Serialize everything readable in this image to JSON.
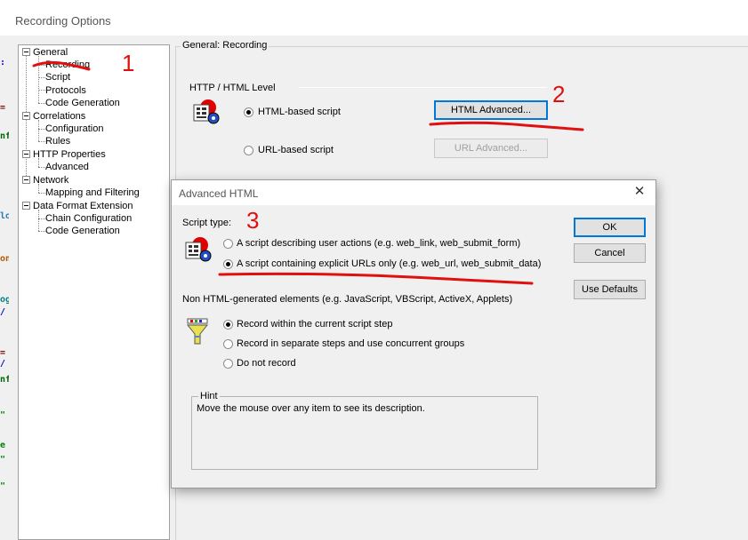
{
  "window": {
    "title": "Recording Options"
  },
  "tree": {
    "items": [
      {
        "label": "General",
        "level": 0,
        "expander": true
      },
      {
        "label": "Recording",
        "level": 1,
        "selected": true
      },
      {
        "label": "Script",
        "level": 1
      },
      {
        "label": "Protocols",
        "level": 1
      },
      {
        "label": "Code Generation",
        "level": 1
      },
      {
        "label": "Correlations",
        "level": 0,
        "expander": true
      },
      {
        "label": "Configuration",
        "level": 1
      },
      {
        "label": "Rules",
        "level": 1
      },
      {
        "label": "HTTP Properties",
        "level": 0,
        "expander": true
      },
      {
        "label": "Advanced",
        "level": 1
      },
      {
        "label": "Network",
        "level": 0,
        "expander": true
      },
      {
        "label": "Mapping and Filtering",
        "level": 1
      },
      {
        "label": "Data Format Extension",
        "level": 0,
        "expander": true
      },
      {
        "label": "Chain Configuration",
        "level": 1
      },
      {
        "label": "Code Generation",
        "level": 1
      }
    ]
  },
  "general_panel": {
    "group_title": "General: Recording",
    "level_title": "HTTP / HTML Level",
    "html_based_label": "HTML-based script",
    "url_based_label": "URL-based script",
    "html_advanced_button": "HTML Advanced...",
    "url_advanced_button": "URL Advanced..."
  },
  "dialog": {
    "title": "Advanced HTML",
    "close_glyph": "✕",
    "script_type_label": "Script type:",
    "option_user_actions": "A script describing user actions (e.g. web_link, web_submit_form)",
    "option_explicit_urls": "A script containing explicit URLs only (e.g. web_url, web_submit_data)",
    "non_html_label": "Non HTML-generated elements (e.g. JavaScript, VBScript, ActiveX, Applets)",
    "record_current": "Record within the current script step",
    "record_separate": "Record in separate steps and use concurrent groups",
    "do_not_record": "Do not record",
    "ok_button": "OK",
    "cancel_button": "Cancel",
    "use_defaults_button": "Use Defaults",
    "hint_title": "Hint",
    "hint_text": "Move the mouse over any item to see its description."
  },
  "annotations": {
    "one": "1",
    "two": "2",
    "three": "3"
  },
  "code_strip": [
    ":",
    "=",
    "nf",
    "lo",
    "on",
    "og",
    "/",
    "=",
    "/",
    "nf",
    "\"",
    "e",
    "\"",
    "\""
  ],
  "colors": {
    "annotation": "#e01010",
    "selection_accent": "#0078d7"
  }
}
